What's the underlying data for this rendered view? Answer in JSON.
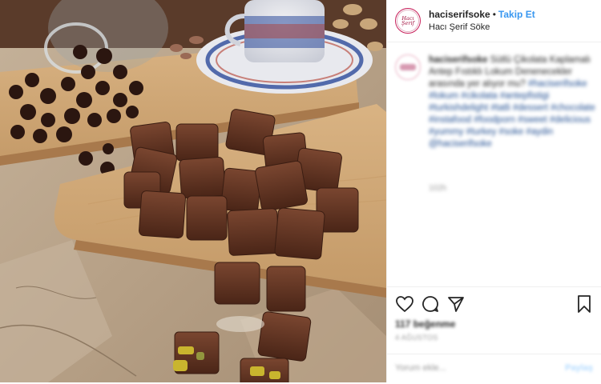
{
  "header": {
    "avatar_text": "Hacı Şerif",
    "username": "haciserifsoke",
    "separator": "•",
    "follow_label": "Takip Et",
    "location": "Hacı Şerif Söke"
  },
  "caption": {
    "avatar_text": "Hacı Şerif",
    "username": "haciserifsoke",
    "text": "Sütlü Çikolata Kaplamalı Antep Fıstıklı Lokum Denenecekler arasında yer alıyor mu?",
    "hashtags": "#haciserifsoke #lokum #cikolata #antepfistigi #turkishdelight #tatli #dessert #chocolate #instafood #foodporn #sweet #delicious #yummy #turkey #soke #aydin @haciserifsoke",
    "time": "102h"
  },
  "actions": {
    "like_icon": "heart-icon",
    "comment_icon": "comment-icon",
    "share_icon": "share-icon",
    "save_icon": "bookmark-icon",
    "likes_text": "117 beğenme",
    "date_text": "4 AĞUSTOS"
  },
  "comment": {
    "placeholder": "Yorum ekle...",
    "post_label": "Paylaş"
  },
  "colors": {
    "accent": "#3897f0",
    "brand": "#a3123f"
  }
}
